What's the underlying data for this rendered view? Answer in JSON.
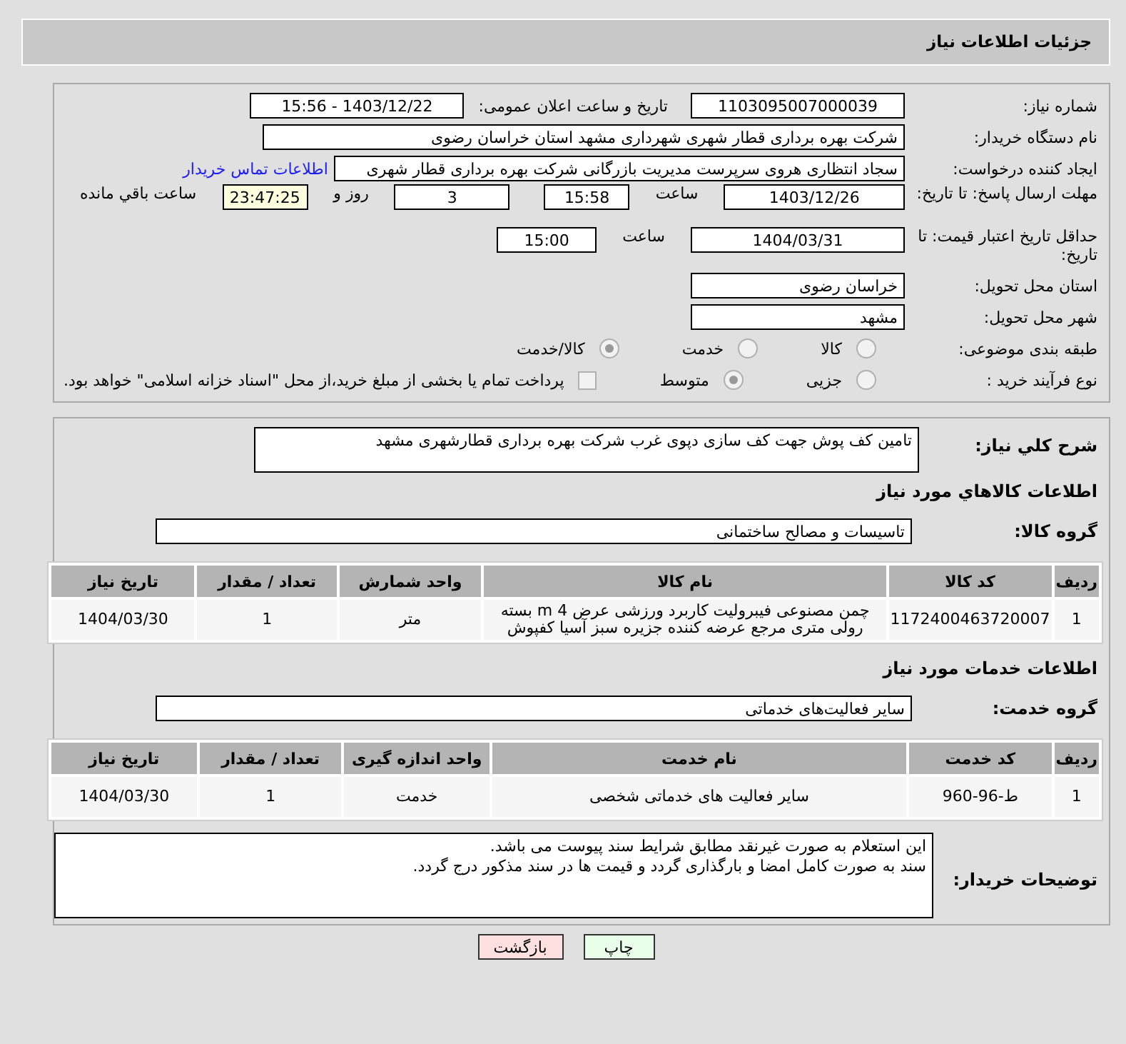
{
  "header": {
    "title": "جزئیات اطلاعات نیاز"
  },
  "details": {
    "need_number": {
      "label": "شماره نیاز:",
      "value": "1103095007000039"
    },
    "announce": {
      "label": "تاریخ و ساعت اعلان عمومی:",
      "value": "1403/12/22 - 15:56"
    },
    "buyer_org": {
      "label": "نام دستگاه خریدار:",
      "value": "شرکت بهره برداری قطار شهری شهرداری مشهد استان خراسان رضوی"
    },
    "requester": {
      "label": "ایجاد کننده درخواست:",
      "value": "سجاد انتظاری هروی سرپرست مدیریت بازرگانی شرکت بهره برداری قطار شهری",
      "link": "اطلاعات تماس خریدار"
    },
    "deadline": {
      "label": "مهلت ارسال پاسخ: تا تاریخ:",
      "date": "1403/12/26",
      "time_label": "ساعت",
      "time": "15:58",
      "days": "3",
      "days_label": "روز و",
      "remaining": "23:47:25",
      "remaining_label": "ساعت باقي مانده"
    },
    "validity": {
      "label": "حداقل تاریخ اعتبار قیمت: تا تاریخ:",
      "date": "1404/03/31",
      "time_label": "ساعت",
      "time": "15:00"
    },
    "province": {
      "label": "استان محل تحویل:",
      "value": "خراسان رضوی"
    },
    "city": {
      "label": "شهر محل تحویل:",
      "value": "مشهد"
    },
    "category": {
      "label": "طبقه بندی موضوعی:",
      "options": [
        {
          "label": "کالا",
          "selected": false
        },
        {
          "label": "خدمت",
          "selected": false
        },
        {
          "label": "کالا/خدمت",
          "selected": true
        }
      ]
    },
    "process": {
      "label": "نوع فرآیند خرید :",
      "options": [
        {
          "label": "جزیی",
          "selected": false
        },
        {
          "label": "متوسط",
          "selected": true
        }
      ],
      "payment": {
        "checked": false,
        "label": "پرداخت تمام یا بخشی از مبلغ خرید،از محل \"اسناد خزانه اسلامی\" خواهد بود."
      }
    }
  },
  "description": {
    "label": "شرح كلي نياز:",
    "value": "تامین کف پوش جهت کف سازی دپوی غرب شرکت بهره برداری قطارشهری مشهد"
  },
  "goods": {
    "title": "اطلاعات كالاهاي مورد نياز",
    "group_label": "گروه کالا:",
    "group": "تاسیسات و مصالح ساختمانی",
    "columns": [
      "ردیف",
      "کد کالا",
      "نام کالا",
      "واحد شمارش",
      "تعداد / مقدار",
      "تاریخ نیاز"
    ],
    "rows": [
      [
        "1",
        "1172400463720007",
        "چمن مصنوعی فیبرولیت کاربرد ورزشی عرض 4 m بسته رولی متری مرجع عرضه کننده جزیره سبز آسیا کفپوش",
        "متر",
        "1",
        "1404/03/30"
      ]
    ]
  },
  "services": {
    "title": "اطلاعات خدمات مورد نیاز",
    "group_label": "گروه خدمت:",
    "group": "سایر فعالیت‌های خدماتی",
    "columns": [
      "ردیف",
      "کد خدمت",
      "نام خدمت",
      "واحد اندازه گیری",
      "تعداد / مقدار",
      "تاریخ نیاز"
    ],
    "rows": [
      [
        "1",
        "ط-96-960",
        "سایر فعالیت های خدماتی شخصی",
        "خدمت",
        "1",
        "1404/03/30"
      ]
    ]
  },
  "buyer_notes": {
    "label": "توضیحات خریدار:",
    "lines": [
      "این استعلام به صورت غیرنقد مطابق شرایط سند پیوست می باشد.",
      "سند به صورت کامل امضا و بارگذاری گردد و قیمت ها در سند مذکور درج گردد."
    ]
  },
  "buttons": [
    {
      "label": "چاپ",
      "kind": "print"
    },
    {
      "label": "بازگشت",
      "kind": "back"
    }
  ]
}
